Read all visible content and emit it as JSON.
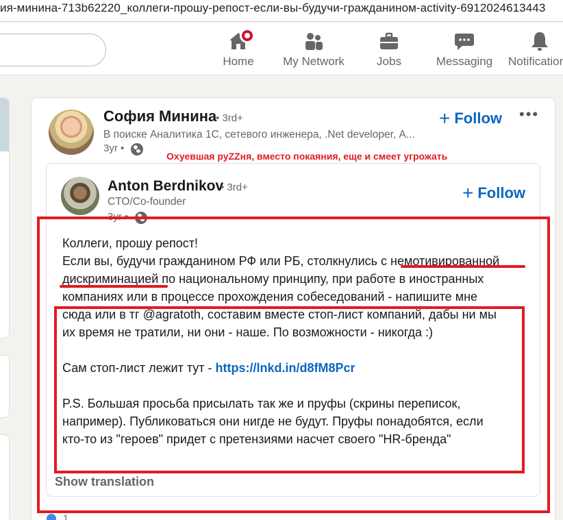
{
  "browser": {
    "url": "ия-минина-713b62220_коллеги-прошу-репост-если-вы-будучи-гражданином-activity-6912024613443"
  },
  "nav": {
    "items": [
      {
        "label": "Home",
        "icon": "home-icon"
      },
      {
        "label": "My Network",
        "icon": "network-icon"
      },
      {
        "label": "Jobs",
        "icon": "briefcase-icon"
      },
      {
        "label": "Messaging",
        "icon": "chat-icon"
      },
      {
        "label": "Notifications",
        "icon": "bell-icon"
      }
    ]
  },
  "post": {
    "author": {
      "name": "София Минина",
      "degree": "• 3rd+",
      "headline": "В поиске Аналитика 1С, сетевого инженера, .Net developer, А...",
      "time": "3yr •"
    },
    "follow_label": "Follow",
    "more_label": "•••",
    "annotation": "Охуевшая руZZня, вместо покаяния, еще и смеет угрожать",
    "reshared": {
      "author": {
        "name": "Anton Berdnikov",
        "degree": "• 3rd+",
        "headline": "CTO/Co-founder",
        "time": "3yr •"
      },
      "follow_label": "Follow",
      "body": {
        "line1": "Коллеги, прошу репост!",
        "line2": "Если вы, будучи гражданином РФ или РБ, столкнулись с немотивированной",
        "line3": "дискриминацией по национальному принципу, при работе в иностранных",
        "line4": "компаниях или в процессе прохождения собеседований - напишите мне",
        "line5": "сюда или в тг @agratoth, составим вместе стоп-лист компаний, дабы ни мы",
        "line6": "их время не тратили, ни они - наше. По возможности - никогда :)",
        "line7_prefix": "Сам стоп-лист лежит тут - ",
        "link": "https://lnkd.in/d8fM8Pcr",
        "line8": "P.S. Большая просьба присылать так же и пруфы (скрины переписок,",
        "line9": "например). Публиковаться они нигде не будут. Пруфы понадобятся, если",
        "line10": "кто-то из \"героев\" придет с претензиями насчет своего \"HR-бренда\""
      },
      "show_translation": "Show translation"
    },
    "reaction_count": "1"
  },
  "colors": {
    "brand_blue": "#0a66c2",
    "annotation_red": "#e11b22",
    "notification_red": "#cb112d"
  }
}
